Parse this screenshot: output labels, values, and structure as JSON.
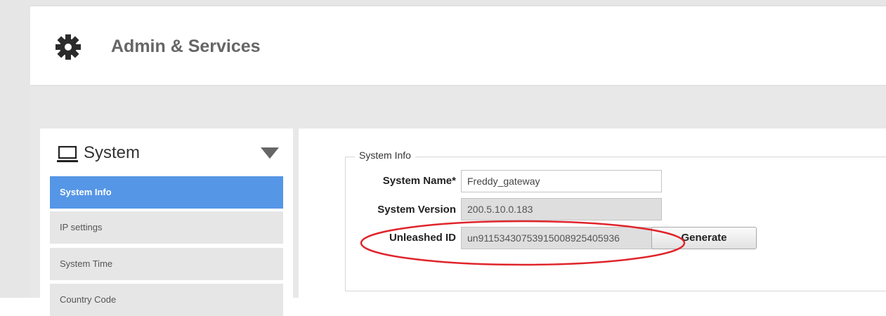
{
  "header": {
    "title": "Admin & Services",
    "icon": "gear-icon"
  },
  "sidebar": {
    "title": "System",
    "icon": "monitor-icon",
    "collapse_icon": "triangle-down-icon",
    "items": [
      {
        "label": "System Info",
        "active": true
      },
      {
        "label": "IP settings",
        "active": false
      },
      {
        "label": "System Time",
        "active": false
      },
      {
        "label": "Country Code",
        "active": false
      }
    ]
  },
  "main": {
    "section_title": "System Info",
    "fields": {
      "system_name": {
        "label": "System Name*",
        "value": "Freddy_gateway"
      },
      "system_version": {
        "label": "System Version",
        "value": "200.5.10.0.183"
      },
      "unleashed_id": {
        "label": "Unleashed ID",
        "value": "un91153430753915008925405936"
      }
    },
    "generate_label": "Generate"
  },
  "colors": {
    "accent": "#5596e6",
    "annotation": "#e0242b",
    "background_gray": "#e8e8e8"
  }
}
